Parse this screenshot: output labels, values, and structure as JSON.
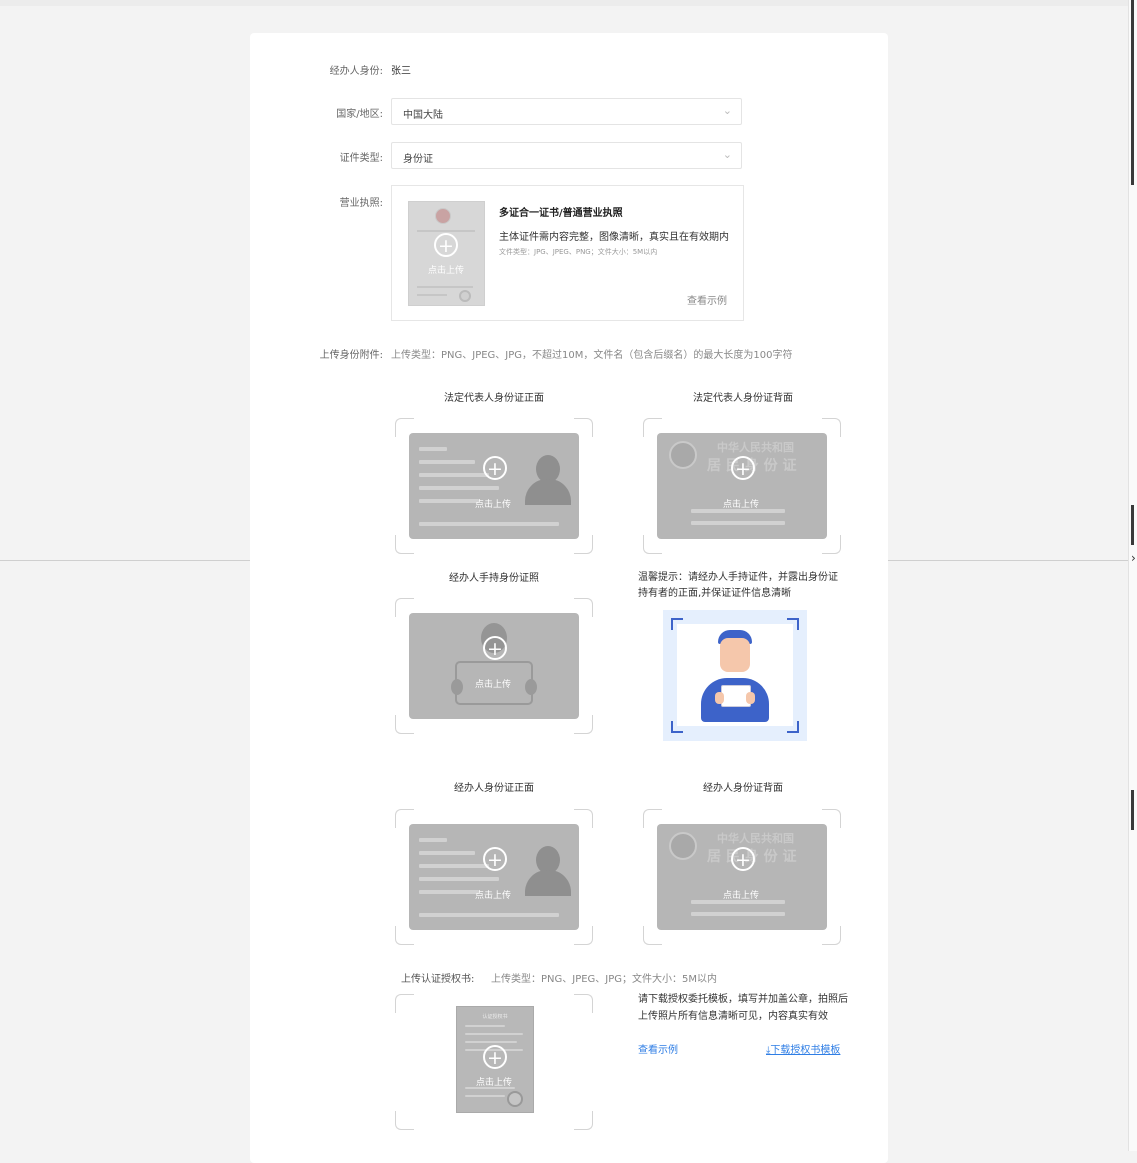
{
  "operator_identity": {
    "label": "经办人身份:",
    "value": "张三"
  },
  "country_region": {
    "label": "国家/地区:",
    "value": "中国大陆"
  },
  "certificate_type": {
    "label": "证件类型:",
    "value": "身份证"
  },
  "business_license": {
    "label": "营业执照:",
    "upload_text": "点击上传",
    "title": "多证合一证书/普通营业执照",
    "desc": "主体证件需内容完整，图像清晰，真实且在有效期内",
    "file_note": "文件类型：JPG、JPEG、PNG；文件大小：5M以内",
    "example_link": "查看示例"
  },
  "id_attachment": {
    "label": "上传身份附件:",
    "note": "上传类型：PNG、JPEG、JPG，不超过10M，文件名（包含后缀名）的最大长度为100字符"
  },
  "cards": {
    "legal_front": {
      "title": "法定代表人身份证正面",
      "upload_text": "点击上传"
    },
    "legal_back": {
      "title": "法定代表人身份证背面",
      "upload_text": "点击上传",
      "back_text1": "中华人民共和国",
      "back_text2": "居 民 身 份 证"
    },
    "handheld": {
      "title": "经办人手持身份证照",
      "upload_text": "点击上传"
    },
    "operator_front": {
      "title": "经办人身份证正面",
      "upload_text": "点击上传"
    },
    "operator_back": {
      "title": "经办人身份证背面",
      "upload_text": "点击上传",
      "back_text1": "中华人民共和国",
      "back_text2": "居 民 身 份 证"
    }
  },
  "handheld_tip": {
    "line1": "温馨提示：请经办人手持证件，并露出身份证",
    "line2": "持有者的正面,并保证证件信息清晰"
  },
  "authorization": {
    "label": "上传认证授权书:",
    "note": "上传类型：PNG、JPEG、JPG；文件大小：5M以内",
    "upload_text": "点击上传",
    "doc_title": "认证授权书",
    "tip_line1": "请下载授权委托模板，填写并加盖公章，拍照后",
    "tip_line2": "上传照片所有信息清晰可见，内容真实有效",
    "example_link": "查看示例",
    "download_link": "⤓下载授权书模板"
  },
  "colors": {
    "accent": "#2f7ee5",
    "placeholder_gray": "#b6b6b6",
    "illustration_blue": "#3d63c9"
  }
}
